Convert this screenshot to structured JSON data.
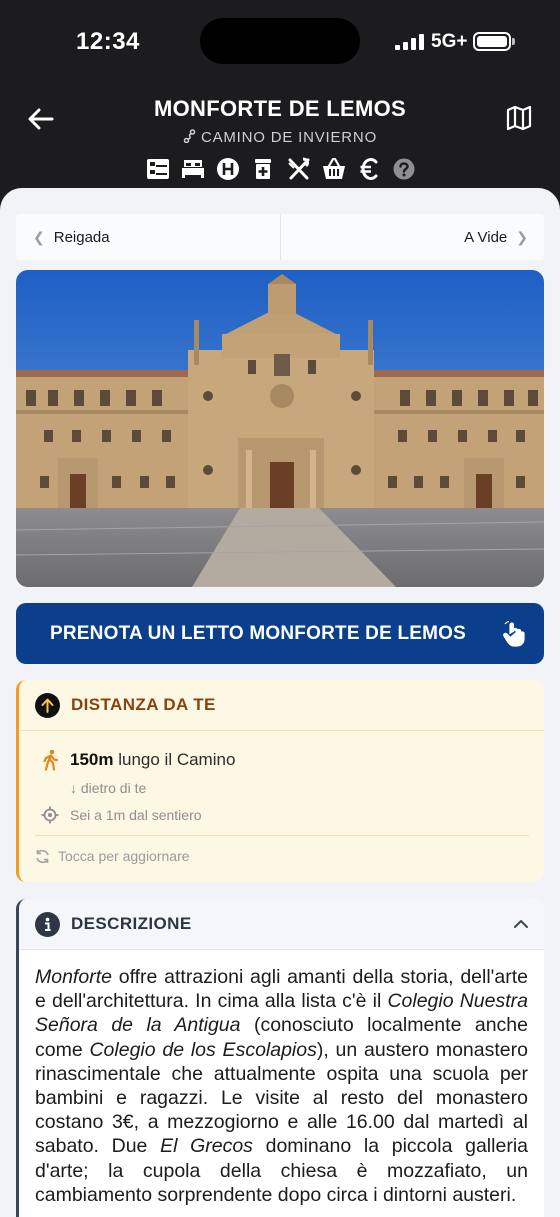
{
  "status_bar": {
    "time": "12:34",
    "network": "5G+",
    "battery_level": 1.0
  },
  "header": {
    "title": "MONFORTE DE LEMOS",
    "route": "CAMINO DE INVIERNO",
    "amenities": [
      "bunk-bed-icon",
      "bed-icon",
      "hotel-h-icon",
      "pharmacy-icon",
      "restaurant-icon",
      "shopping-basket-icon",
      "euro-icon",
      "help-icon"
    ]
  },
  "nav": {
    "prev": "Reigada",
    "next": "A Vide"
  },
  "hero_image": "monastery-facade-photo",
  "book_button": "PRENOTA UN LETTO MONFORTE DE LEMOS",
  "distance": {
    "title": "DISTANZA DA TE",
    "amount": "150m",
    "along": "lungo il Camino",
    "behind": "↓ dietro di te",
    "from_path": "Sei a 1m dal sentiero",
    "refresh": "Tocca per aggiornare"
  },
  "description": {
    "title": "DESCRIZIONE",
    "segments": [
      {
        "text": "Monforte",
        "italic": true
      },
      {
        "text": " offre attrazioni agli amanti della storia, dell'arte e dell'architettura. In cima alla lista c'è il ",
        "italic": false
      },
      {
        "text": "Colegio Nuestra Señora de la Antigua",
        "italic": true
      },
      {
        "text": " (conosciuto localmente anche come ",
        "italic": false
      },
      {
        "text": "Colegio de los Escolapios",
        "italic": true
      },
      {
        "text": "), un austero monastero rinascimentale che attualmente ospita una scuola per bambini e ragazzi. Le visite al resto del monastero costano 3€, a mezzogiorno e alle 16.00 dal martedì al sabato. Due ",
        "italic": false
      },
      {
        "text": "El Grecos",
        "italic": true
      },
      {
        "text": " dominano la piccola galleria d'arte; la cupola della chiesa è mozzafiato, un cambiamento sorprendente dopo circa i dintorni austeri.",
        "italic": false
      }
    ]
  },
  "colors": {
    "header_bg": "#1c1c1e",
    "primary": "#0b3f8c",
    "distance_accent": "#f29b1e",
    "distance_title": "#8a4210",
    "sheet_bg": "#f2f3f6"
  }
}
